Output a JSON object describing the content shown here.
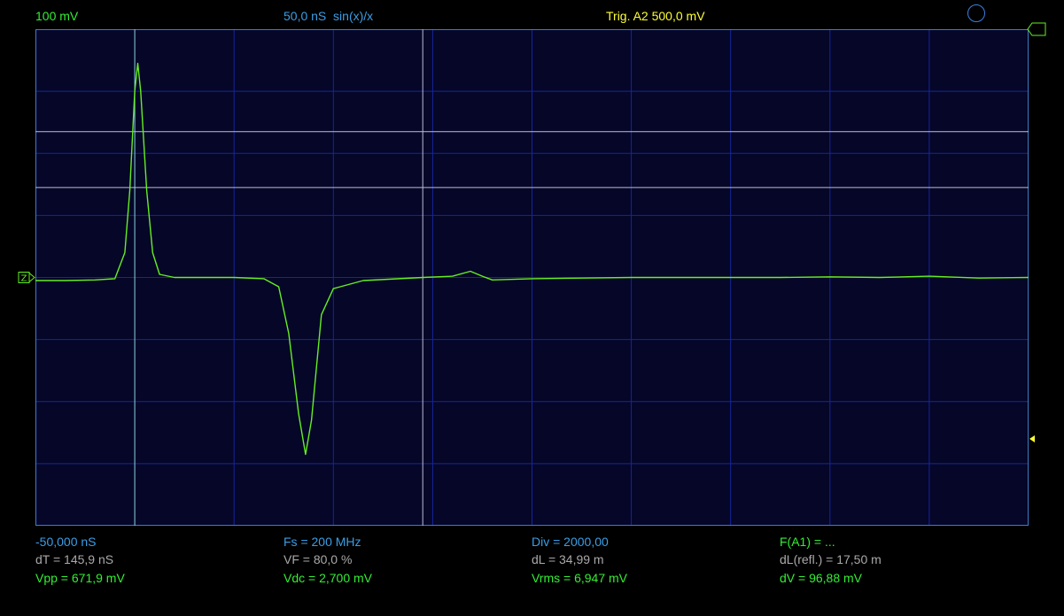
{
  "colors": {
    "background": "#000000",
    "screen_bg": "#050628",
    "grid": "#16269a",
    "screen_border": "#3b7ccc",
    "trace": "#66ee22",
    "cursor_h": "#bdbdd6",
    "cursor_v": "#8ad0d0",
    "green_text": "#33ee33",
    "blue_text": "#3a9ee6",
    "gray_text": "#a9a9a9",
    "yellow_text": "#ffff33"
  },
  "header": {
    "volts_per_div": "100 mV",
    "timebase": "50,0 nS",
    "interpolation": "sin(x)/x",
    "trigger": "Trig. A2  500,0 mV"
  },
  "icons": {
    "run_indicator": "circle-icon",
    "ground_marker": "channel-ground-marker-icon",
    "trigger_level_marker": "trigger-level-arrow-icon",
    "trigger_position_marker": "trigger-position-arrow-icon"
  },
  "ground_marker_label": "Z",
  "measurements": {
    "row1": {
      "time_offset": "-50,000 nS",
      "sample_rate": "Fs = 200 MHz",
      "division": "Div = 2000,00",
      "function": "F(A1) = ..."
    },
    "row2": {
      "delta_t": "dT = 145,9 nS",
      "velocity_factor": "VF = 80,0 %",
      "delta_l": "dL = 34,99 m",
      "delta_l_reflected": "dL(refl.) = 17,50 m"
    },
    "row3": {
      "vpp": "Vpp = 671,9 mV",
      "vdc": "Vdc = 2,700 mV",
      "vrms": "Vrms = 6,947 mV",
      "delta_v": "dV = 96,88 mV"
    }
  },
  "chart_data": {
    "type": "line",
    "grid": true,
    "divisions": {
      "x": 10,
      "y": 8
    },
    "xlim": [
      0,
      10
    ],
    "ylim": [
      -4,
      4
    ],
    "series": [
      {
        "points": [
          [
            0,
            -0.05
          ],
          [
            0.3,
            -0.05
          ],
          [
            0.6,
            -0.04
          ],
          [
            0.8,
            -0.02
          ],
          [
            0.9,
            0.4
          ],
          [
            0.95,
            1.4
          ],
          [
            1.0,
            3.0
          ],
          [
            1.03,
            3.45
          ],
          [
            1.06,
            3.0
          ],
          [
            1.12,
            1.4
          ],
          [
            1.18,
            0.4
          ],
          [
            1.25,
            0.05
          ],
          [
            1.4,
            0.0
          ],
          [
            2.0,
            0.0
          ],
          [
            2.3,
            -0.02
          ],
          [
            2.45,
            -0.15
          ],
          [
            2.55,
            -0.9
          ],
          [
            2.65,
            -2.2
          ],
          [
            2.72,
            -2.85
          ],
          [
            2.78,
            -2.3
          ],
          [
            2.88,
            -0.6
          ],
          [
            3.0,
            -0.18
          ],
          [
            3.3,
            -0.05
          ],
          [
            3.9,
            0.0
          ],
          [
            4.2,
            0.02
          ],
          [
            4.38,
            0.1
          ],
          [
            4.5,
            0.02
          ],
          [
            4.6,
            -0.04
          ],
          [
            5.0,
            -0.02
          ],
          [
            5.5,
            -0.01
          ],
          [
            6.0,
            0.0
          ],
          [
            7.0,
            0.0
          ],
          [
            7.5,
            0.0
          ],
          [
            8.0,
            0.01
          ],
          [
            8.5,
            0.0
          ],
          [
            9.0,
            0.02
          ],
          [
            9.5,
            -0.01
          ],
          [
            10.0,
            0.0
          ]
        ]
      }
    ],
    "cursors": {
      "vertical": [
        1.0,
        3.9
      ],
      "horizontal": [
        2.35,
        1.45
      ]
    },
    "trigger_level": -2.6
  }
}
